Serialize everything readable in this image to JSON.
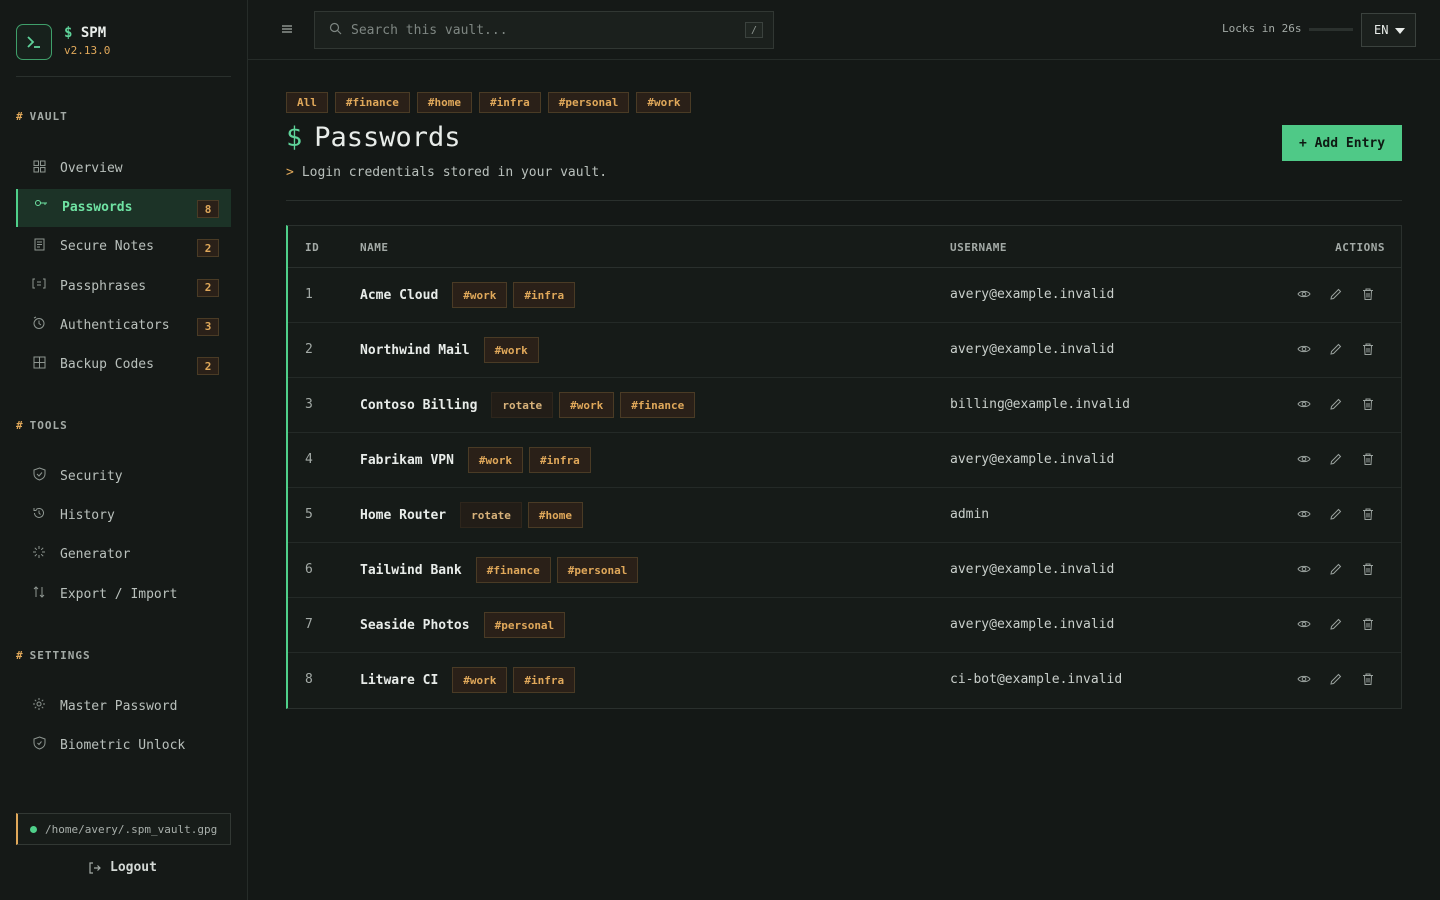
{
  "brand": {
    "name": "SPM",
    "prompt": "$",
    "version": "v2.13.0"
  },
  "sidebar": {
    "sections": [
      {
        "title": "VAULT",
        "items": [
          {
            "label": "Overview",
            "icon": "grid-icon",
            "count": ""
          },
          {
            "label": "Passwords",
            "icon": "key-icon",
            "count": "8",
            "active": true
          },
          {
            "label": "Secure Notes",
            "icon": "note-icon",
            "count": "2"
          },
          {
            "label": "Passphrases",
            "icon": "bracket-text-icon",
            "count": "2"
          },
          {
            "label": "Authenticators",
            "icon": "clock-icon",
            "count": "3"
          },
          {
            "label": "Backup Codes",
            "icon": "table-grid-icon",
            "count": "2"
          }
        ]
      },
      {
        "title": "TOOLS",
        "items": [
          {
            "label": "Security",
            "icon": "shield-check-icon"
          },
          {
            "label": "History",
            "icon": "history-icon"
          },
          {
            "label": "Generator",
            "icon": "sparkle-icon"
          },
          {
            "label": "Export / Import",
            "icon": "arrows-up-down-icon"
          }
        ]
      },
      {
        "title": "SETTINGS",
        "items": [
          {
            "label": "Master Password",
            "icon": "gear-icon"
          },
          {
            "label": "Biometric Unlock",
            "icon": "shield-icon"
          }
        ]
      }
    ],
    "section_prefix": "#",
    "vault_path": "/home/avery/.spm_vault.gpg",
    "logout_label": "Logout"
  },
  "topbar": {
    "search_placeholder": "Search this vault...",
    "search_shortcut": "/",
    "lock_text": "Locks in 26s",
    "lock_progress": 0.0,
    "language": "EN"
  },
  "main": {
    "filters": [
      "All",
      "#finance",
      "#home",
      "#infra",
      "#personal",
      "#work"
    ],
    "title_prompt": "$",
    "title": "Passwords",
    "subtitle_prompt": ">",
    "subtitle": "Login credentials stored in your vault.",
    "add_button": "+ Add Entry",
    "table": {
      "headers": {
        "id": "ID",
        "name": "NAME",
        "username": "USERNAME",
        "actions": "ACTIONS"
      },
      "rows": [
        {
          "id": "1",
          "name": "Acme Cloud",
          "tags": [
            "#work",
            "#infra"
          ],
          "username": "avery@example.invalid"
        },
        {
          "id": "2",
          "name": "Northwind Mail",
          "tags": [
            "#work"
          ],
          "username": "avery@example.invalid"
        },
        {
          "id": "3",
          "name": "Contoso Billing",
          "tags": [
            "rotate",
            "#work",
            "#finance"
          ],
          "username": "billing@example.invalid"
        },
        {
          "id": "4",
          "name": "Fabrikam VPN",
          "tags": [
            "#work",
            "#infra"
          ],
          "username": "avery@example.invalid"
        },
        {
          "id": "5",
          "name": "Home Router",
          "tags": [
            "rotate",
            "#home"
          ],
          "username": "admin"
        },
        {
          "id": "6",
          "name": "Tailwind Bank",
          "tags": [
            "#finance",
            "#personal"
          ],
          "username": "avery@example.invalid"
        },
        {
          "id": "7",
          "name": "Seaside Photos",
          "tags": [
            "#personal"
          ],
          "username": "avery@example.invalid"
        },
        {
          "id": "8",
          "name": "Litware CI",
          "tags": [
            "#work",
            "#infra"
          ],
          "username": "ci-bot@example.invalid"
        }
      ]
    }
  },
  "colors": {
    "accent": "#4fc987",
    "tag": "#e0a85a",
    "background": "#141816"
  }
}
